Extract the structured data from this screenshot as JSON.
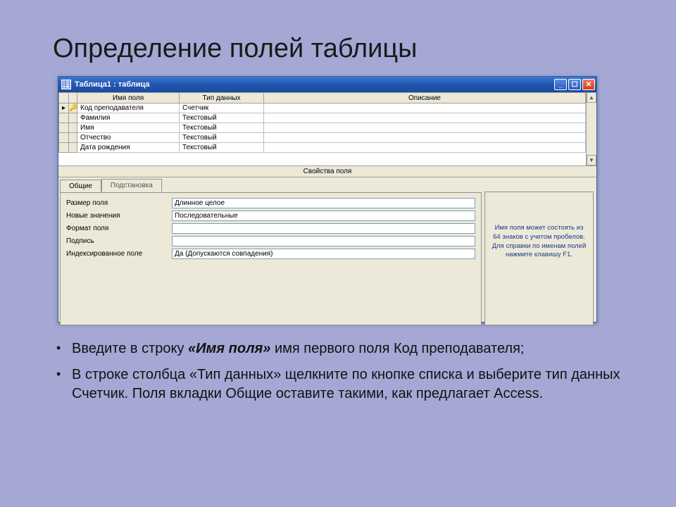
{
  "slide": {
    "title": "Определение полей таблицы",
    "bullets": [
      {
        "pre": "Введите в строку ",
        "emph": "«Имя поля»",
        "post": " имя первого поля Код преподавателя;"
      },
      {
        "text": "В строке столбца «Тип данных» щелкните по кнопке списка и выберите тип данных Счетчик. Поля вкладки Общие оставите такими, как предлагает Access."
      }
    ]
  },
  "window": {
    "title": "Таблица1 : таблица",
    "columns": {
      "name": "Имя поля",
      "type": "Тип данных",
      "desc": "Описание"
    },
    "rows": [
      {
        "name": "Код преподавателя",
        "type": "Счетчик",
        "key": true,
        "current": true
      },
      {
        "name": "Фамилия",
        "type": "Текстовый"
      },
      {
        "name": "Имя",
        "type": "Текстовый"
      },
      {
        "name": "Отчество",
        "type": "Текстовый"
      },
      {
        "name": "Дата рождения",
        "type": "Текстовый"
      }
    ],
    "props_header": "Свойства поля",
    "tabs": {
      "general": "Общие",
      "lookup": "Подстановка"
    },
    "properties": [
      {
        "label": "Размер поля",
        "value": "Длинное целое"
      },
      {
        "label": "Новые значения",
        "value": "Последовательные"
      },
      {
        "label": "Формат поля",
        "value": ""
      },
      {
        "label": "Подпись",
        "value": ""
      },
      {
        "label": "Индексированное поле",
        "value": "Да (Допускаются совпадения)"
      }
    ],
    "hint": "Имя поля может состоять из 64 знаков с учетом пробелов. Для справки по именам полей нажмите клавишу F1."
  }
}
